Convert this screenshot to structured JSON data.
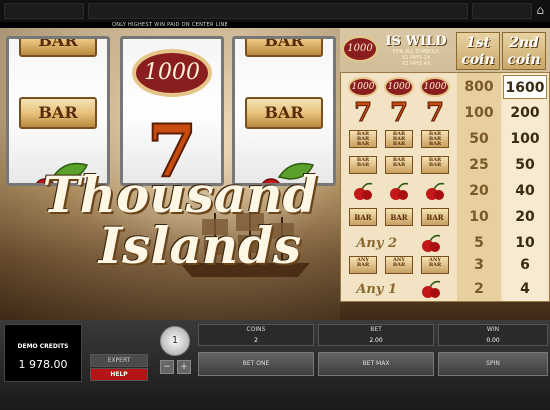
{
  "notice": "ONLY HIGHEST WIN PAID ON CENTER LINE",
  "home_icon": "home-icon",
  "title": {
    "line1": "Thousand",
    "line2": "Islands"
  },
  "reels": {
    "reel1": {
      "top": "BAR",
      "middle": "BAR",
      "bottom": "cherry"
    },
    "reel2": {
      "top": "1000",
      "middle": "7"
    },
    "reel3": {
      "top": "BAR",
      "middle": "BAR",
      "bottom": "cherry"
    }
  },
  "paytable": {
    "wild_coin": "1000",
    "wild_title": "IS WILD",
    "wild_sub1": "FOR ALL SYMBOLS",
    "wild_sub2": "X1 PAYS 2X",
    "wild_sub3": "X2 PAYS 4X",
    "col1": "1st coin",
    "col2": "2nd coin",
    "coin_sym": "1000",
    "seven_sym": "7",
    "bar_triple": "BAR BAR BAR",
    "bar_double": "BAR BAR",
    "bar_single": "BAR",
    "any_bar": "ANY BAR",
    "any2": "Any 2",
    "any1": "Any 1",
    "rows": [
      {
        "c1": "800",
        "c2": "1600"
      },
      {
        "c1": "100",
        "c2": "200"
      },
      {
        "c1": "50",
        "c2": "100"
      },
      {
        "c1": "25",
        "c2": "50"
      },
      {
        "c1": "20",
        "c2": "40"
      },
      {
        "c1": "10",
        "c2": "20"
      },
      {
        "c1": "5",
        "c2": "10"
      },
      {
        "c1": "3",
        "c2": "6"
      },
      {
        "c1": "2",
        "c2": "4"
      }
    ]
  },
  "controls": {
    "credits_label": "DEMO CREDITS",
    "credits_value": "1 978.00",
    "expert": "EXPERT",
    "help": "HELP",
    "coin_size": "1",
    "minus": "−",
    "plus": "+",
    "coins_label": "COINS",
    "coins_value": "2",
    "bet_label": "BET",
    "bet_value": "2.00",
    "win_label": "WIN",
    "win_value": "0.00",
    "bet_one": "BET ONE",
    "bet_max": "BET MAX",
    "spin": "SPIN"
  },
  "colors": {
    "seven": "#c84b10",
    "coin": "#8a1d1d",
    "help": "#b51515",
    "paytable_bg": "#f1e3c3"
  }
}
